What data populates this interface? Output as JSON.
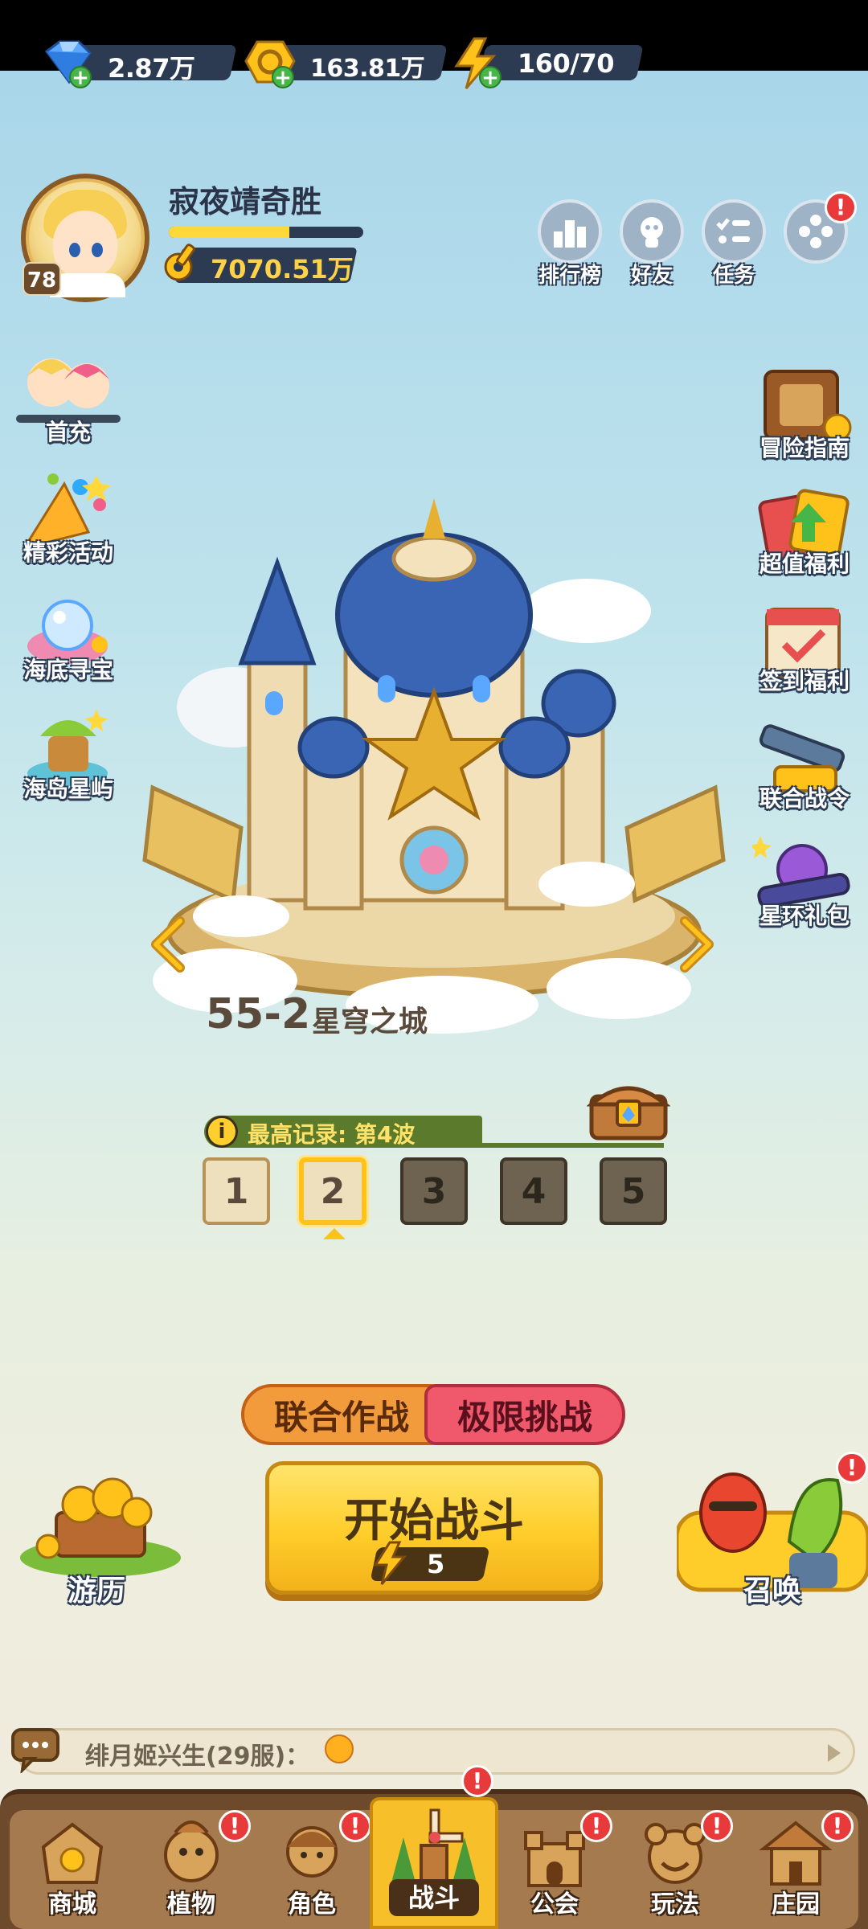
{
  "currencies": {
    "gems": "2.87万",
    "coins": "163.81万",
    "energy": "160/70"
  },
  "profile": {
    "name": "寂夜靖奇胜",
    "level": "78",
    "xp_progress": 0.62,
    "gold": "7070.51万"
  },
  "top_buttons": {
    "ranking": "排行榜",
    "friends": "好友",
    "tasks": "任务",
    "more_alert": "!"
  },
  "left_events": [
    "首充",
    "精彩活动",
    "海底寻宝",
    "海岛星屿"
  ],
  "right_events": [
    "冒险指南",
    "超值福利",
    "签到福利",
    "联合战令",
    "星环礼包"
  ],
  "stage": {
    "number": "55-2",
    "name": "星穹之城",
    "record": "最高记录: 第4波",
    "record_icon": "i",
    "waves": [
      {
        "label": "1",
        "state": "open"
      },
      {
        "label": "2",
        "state": "selected"
      },
      {
        "label": "3",
        "state": "locked"
      },
      {
        "label": "4",
        "state": "locked"
      },
      {
        "label": "5",
        "state": "locked"
      }
    ]
  },
  "modes": {
    "coop": "联合作战",
    "limit": "极限挑战"
  },
  "start": {
    "label": "开始战斗",
    "cost": "5"
  },
  "corners": {
    "travel": "游历",
    "summon": "召唤",
    "summon_alert": "!"
  },
  "chat": {
    "message": "绯月姬兴生(29服)："
  },
  "nav": {
    "items": [
      "商城",
      "植物",
      "角色",
      "战斗",
      "公会",
      "玩法",
      "庄园"
    ],
    "active": "战斗",
    "alert": "!"
  },
  "colors": {
    "accent_yellow": "#ffcd2a",
    "alert_red": "#e83a3a",
    "pill_dark": "#2c3a52",
    "nav_brown": "#6e4a2c"
  }
}
